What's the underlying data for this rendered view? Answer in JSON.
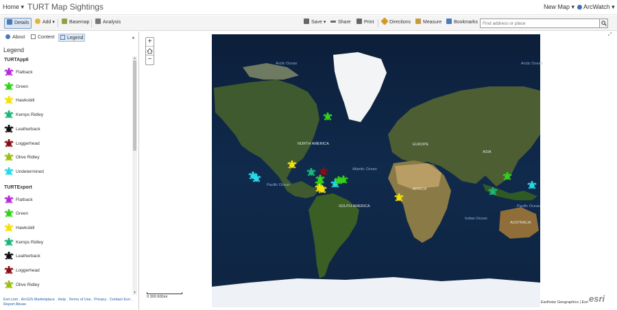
{
  "header": {
    "home_label": "Home ▾",
    "map_title": "TURT Map Sightings",
    "new_map_label": "New Map ▾",
    "user_label": "ArcWatch ▾"
  },
  "toolbar": {
    "details": "Details",
    "add": "Add ▾",
    "basemap": "Basemap",
    "analysis": "Analysis",
    "save": "Save ▾",
    "share": "Share",
    "print": "Print",
    "directions": "Directions",
    "measure": "Measure",
    "bookmarks": "Bookmarks",
    "search_placeholder": "Find address or place"
  },
  "sidebar": {
    "tabs": {
      "about": "About",
      "content": "Content",
      "legend": "Legend"
    },
    "legend_title": "Legend",
    "layers": [
      {
        "name": "TURTApp6",
        "items": [
          {
            "label": "Flatback",
            "color": "#b52bdb"
          },
          {
            "label": "Green",
            "color": "#33d11b"
          },
          {
            "label": "Hawksbill",
            "color": "#f4e00c"
          },
          {
            "label": "Kemps Ridley",
            "color": "#1db57a"
          },
          {
            "label": "Leatherback",
            "color": "#111111"
          },
          {
            "label": "Loggerhead",
            "color": "#8a0d14"
          },
          {
            "label": "Olive Ridley",
            "color": "#9fbd10"
          },
          {
            "label": "Undetermined",
            "color": "#29d8e4"
          }
        ]
      },
      {
        "name": "TURTExport",
        "items": [
          {
            "label": "Flatback",
            "color": "#b52bdb"
          },
          {
            "label": "Green",
            "color": "#33d11b"
          },
          {
            "label": "Hawksbill",
            "color": "#f4e00c"
          },
          {
            "label": "Kemps Ridley",
            "color": "#1db57a"
          },
          {
            "label": "Leatherback",
            "color": "#111111"
          },
          {
            "label": "Loggerhead",
            "color": "#8a0d14"
          },
          {
            "label": "Olive Ridley",
            "color": "#9fbd10"
          }
        ]
      }
    ],
    "footer": "Esri.com . ArcGIS Marketplace . Help . Terms of Use . Privacy . Contact Esri . Report Abuse"
  },
  "map": {
    "labels": {
      "arctic_left": "Arctic Ocean",
      "arctic_right": "Arctic Ocean",
      "north_america": "NORTH AMERICA",
      "europe": "EUROPE",
      "asia": "ASIA",
      "atlantic": "Atlantic Ocean",
      "pacific_left": "Pacific Ocean",
      "pacific_right": "Pacific Ocean",
      "africa": "AFRICA",
      "south_america": "SOUTH AMERICA",
      "indian": "Indian Ocean",
      "australia": "AUSTRALIA"
    },
    "scale_label": "0     300     600mi",
    "attribution": "Earthstar Geographics | Esri",
    "logo": "esri",
    "sightings": [
      {
        "species": "Green",
        "color": "#33d11b"
      },
      {
        "species": "Undetermined",
        "color": "#29d8e4"
      },
      {
        "species": "Undetermined",
        "color": "#29d8e4"
      },
      {
        "species": "Hawksbill",
        "color": "#f4e00c"
      },
      {
        "species": "Kemps Ridley",
        "color": "#1db57a"
      },
      {
        "species": "Loggerhead",
        "color": "#8a0d14"
      },
      {
        "species": "Green",
        "color": "#33d11b"
      },
      {
        "species": "Green",
        "color": "#33d11b"
      },
      {
        "species": "Hawksbill",
        "color": "#f4e00c"
      },
      {
        "species": "Hawksbill",
        "color": "#f4e00c"
      },
      {
        "species": "Undetermined",
        "color": "#29d8e4"
      },
      {
        "species": "Green",
        "color": "#33d11b"
      },
      {
        "species": "Green",
        "color": "#33d11b"
      },
      {
        "species": "Hawksbill",
        "color": "#f4e00c"
      },
      {
        "species": "Green",
        "color": "#33d11b"
      },
      {
        "species": "Kemps Ridley",
        "color": "#1db57a"
      },
      {
        "species": "Undetermined",
        "color": "#29d8e4"
      }
    ]
  }
}
